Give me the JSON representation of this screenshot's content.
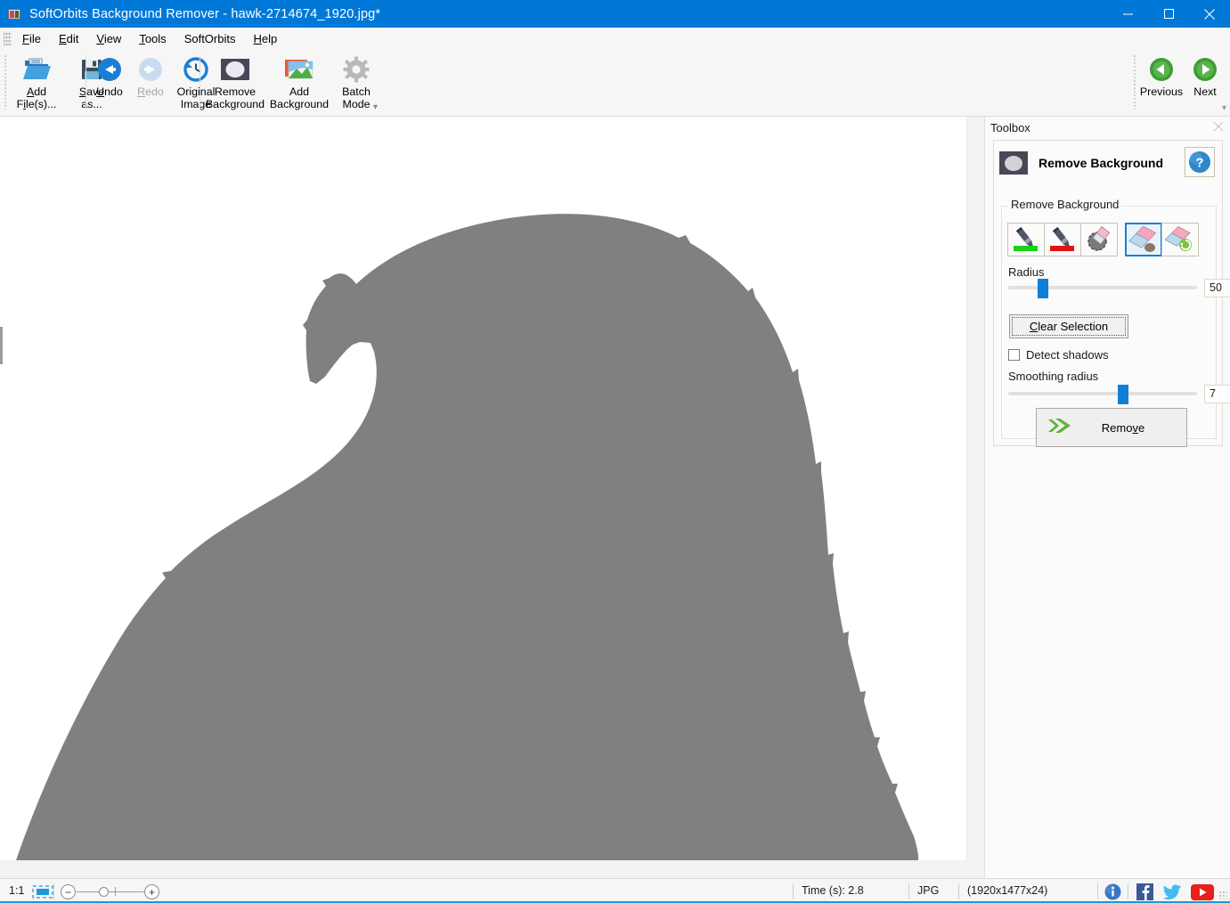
{
  "window": {
    "title": "SoftOrbits Background Remover - hawk-2714674_1920.jpg*",
    "icon": "app-icon",
    "minimize_label": "Minimize",
    "maximize_label": "Maximize",
    "close_label": "Close"
  },
  "menu": {
    "items": [
      {
        "label": "File",
        "mnemonic": "F"
      },
      {
        "label": "Edit",
        "mnemonic": "E"
      },
      {
        "label": "View",
        "mnemonic": "V"
      },
      {
        "label": "Tools",
        "mnemonic": "T"
      },
      {
        "label": "SoftOrbits",
        "mnemonic": ""
      },
      {
        "label": "Help",
        "mnemonic": "H"
      }
    ]
  },
  "toolbar": {
    "buttons": [
      {
        "id": "add-files",
        "line1": "Add",
        "line2": "File(s)...",
        "icon": "open-folder-icon",
        "disabled": false
      },
      {
        "id": "save-as",
        "line1": "Save",
        "line2": "as...",
        "icon": "floppy-disk-icon",
        "disabled": false
      },
      {
        "id": "undo",
        "line1": "Undo",
        "line2": "",
        "icon": "undo-arrow-icon",
        "disabled": false
      },
      {
        "id": "redo",
        "line1": "Redo",
        "line2": "",
        "icon": "redo-arrow-icon",
        "disabled": true
      },
      {
        "id": "original-image",
        "line1": "Original",
        "line2": "Image",
        "icon": "clock-revert-icon",
        "disabled": false
      },
      {
        "id": "remove-background",
        "line1": "Remove",
        "line2": "Background",
        "icon": "remove-background-icon",
        "disabled": false
      },
      {
        "id": "add-background",
        "line1": "Add",
        "line2": "Background",
        "icon": "add-background-icon",
        "disabled": false
      },
      {
        "id": "batch-mode",
        "line1": "Batch",
        "line2": "Mode",
        "icon": "gear-icon",
        "disabled": false
      },
      {
        "id": "previous",
        "line1": "Previous",
        "line2": "",
        "icon": "previous-arrow-icon",
        "disabled": false
      },
      {
        "id": "next",
        "line1": "Next",
        "line2": "",
        "icon": "next-arrow-icon",
        "disabled": false
      }
    ]
  },
  "canvas": {
    "image_name": "hawk-2714674_1920.jpg",
    "silhouette_color": "#808080",
    "background_color": "#ffffff",
    "description": "hawk head silhouette"
  },
  "toolbox": {
    "panel_title": "Toolbox",
    "close_label": "×",
    "section": {
      "title": "Remove Background",
      "icon": "remove-background-icon",
      "help_label": "?",
      "group_legend": "Remove Background",
      "tools": [
        {
          "id": "mark-foreground",
          "icon": "green-marker-icon",
          "selected": false
        },
        {
          "id": "mark-background",
          "icon": "red-marker-icon",
          "selected": false
        },
        {
          "id": "eraser",
          "icon": "eraser-circle-icon",
          "selected": false
        },
        {
          "id": "magic-eraser",
          "icon": "magic-eraser-icon",
          "selected": true
        },
        {
          "id": "restore-eraser",
          "icon": "restore-eraser-icon",
          "selected": false
        }
      ],
      "radius": {
        "label": "Radius",
        "value": "50",
        "percent": 18
      },
      "clear_selection": {
        "label": "Clear Selection",
        "mnemonic": "C"
      },
      "detect_shadows": {
        "label": "Detect shadows",
        "checked": false
      },
      "smoothing_radius": {
        "label": "Smoothing radius",
        "value": "7",
        "percent": 63
      },
      "remove_button": {
        "label": "Remove",
        "mnemonic": "v",
        "icon": "green-double-arrow-icon"
      }
    }
  },
  "statusbar": {
    "zoom_ratio": "1:1",
    "fit_icon": "fit-to-window-icon",
    "zoom_out_label": "−",
    "zoom_in_label": "+",
    "time_label": "Time (s): 2.8",
    "format_label": "JPG",
    "dimensions_label": "(1920x1477x24)",
    "icons": [
      {
        "id": "info",
        "name": "info-icon"
      },
      {
        "id": "facebook",
        "name": "facebook-icon"
      },
      {
        "id": "twitter",
        "name": "twitter-icon"
      },
      {
        "id": "youtube",
        "name": "youtube-icon"
      }
    ]
  }
}
